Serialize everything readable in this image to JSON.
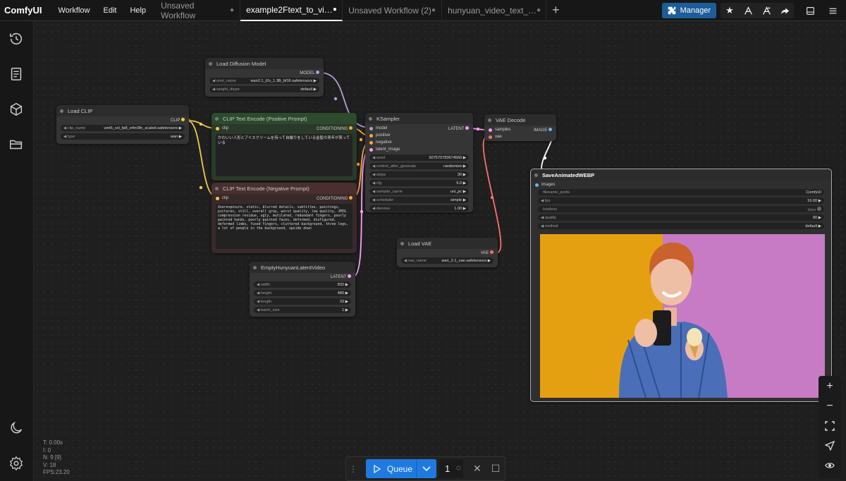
{
  "app": {
    "brand": "ComfyUI"
  },
  "menu": [
    "Workflow",
    "Edit",
    "Help"
  ],
  "tabs": [
    {
      "label": "Unsaved Workflow",
      "active": false
    },
    {
      "label": "example2Ftext_to_vi…",
      "active": true
    },
    {
      "label": "Unsaved Workflow (2)",
      "active": false
    },
    {
      "label": "hunyuan_video_text_…",
      "active": false
    }
  ],
  "toolbar": {
    "manager_label": "Manager"
  },
  "nodes": {
    "load_diffusion": {
      "title": "Load Diffusion Model",
      "out": "MODEL",
      "unet_label": "unet_name",
      "unet_value": "wan2.1_t2v_1.3B_bf16.safetensors",
      "dtype_label": "weight_dtype",
      "dtype_value": "default"
    },
    "load_clip": {
      "title": "Load CLIP",
      "out": "CLIP",
      "clip_label": "clip_name",
      "clip_value": "umt5_xxl_fp8_e4m3fn_scaled.safetensors",
      "type_label": "type",
      "type_value": "wan"
    },
    "clip_pos": {
      "title": "CLIP Text Encode (Positive Prompt)",
      "in": "clip",
      "out": "CONDITIONING",
      "text": "かわいい人形とアイスクリームを持って自撮りをしている金髪の青年が笑っている"
    },
    "clip_neg": {
      "title": "CLIP Text Encode (Negative Prompt)",
      "in": "clip",
      "out": "CONDITIONING",
      "text": "Overexposure, static, blurred details, subtitles, paintings, pictures, still, overall gray, worst quality, low quality, JPEG compression residue, ugly, mutilated, redundant fingers, poorly painted hands, poorly painted faces, deformed, disfigured, deformed limbs, fused fingers, cluttered background, three legs, a lot of people in the background, upside down"
    },
    "ksampler": {
      "title": "KSampler",
      "out": "LATENT",
      "inputs": [
        "model",
        "positive",
        "negative",
        "latent_image"
      ],
      "widgets": [
        {
          "label": "seed",
          "value": "507570783674560"
        },
        {
          "label": "control_after_generate",
          "value": "randomize"
        },
        {
          "label": "steps",
          "value": "30"
        },
        {
          "label": "cfg",
          "value": "6.0"
        },
        {
          "label": "sampler_name",
          "value": "uni_pc"
        },
        {
          "label": "scheduler",
          "value": "simple"
        },
        {
          "label": "denoise",
          "value": "1.00"
        }
      ]
    },
    "vae_decode": {
      "title": "VAE Decode",
      "in1": "samples",
      "in2": "vae",
      "out": "IMAGE"
    },
    "load_vae": {
      "title": "Load VAE",
      "out": "VAE",
      "label": "vae_name",
      "value": "wan_2.1_vae.safetensors"
    },
    "latent": {
      "title": "EmptyHunyuanLatentVideo",
      "out": "LATENT",
      "widgets": [
        {
          "label": "width",
          "value": "832"
        },
        {
          "label": "height",
          "value": "480"
        },
        {
          "label": "length",
          "value": "33"
        },
        {
          "label": "batch_size",
          "value": "1"
        }
      ]
    },
    "save_webp": {
      "title": "SaveAnimatedWEBP",
      "in": "images",
      "widgets": [
        {
          "label": "filename_prefix",
          "value": "ComfyUI"
        },
        {
          "label": "fps",
          "value": "16.00"
        },
        {
          "label": "lossless",
          "value": "false"
        },
        {
          "label": "quality",
          "value": "90"
        },
        {
          "label": "method",
          "value": "default"
        }
      ]
    }
  },
  "stats": {
    "t": "T: 0.00s",
    "i": "I: 0",
    "n": "N: 9 [9]",
    "v": "V: 18",
    "fps": "FPS:23.20"
  },
  "queue": {
    "label": "Queue",
    "count": "1"
  },
  "colors": {
    "accent": "#1f7ae0",
    "manager": "#1d5d99",
    "clip_link": "#f2c94c",
    "model_link": "#b39ddb",
    "latent_link": "#ff9cf9",
    "vae_link": "#ff6e6e",
    "cond_link": "#ffa931"
  }
}
